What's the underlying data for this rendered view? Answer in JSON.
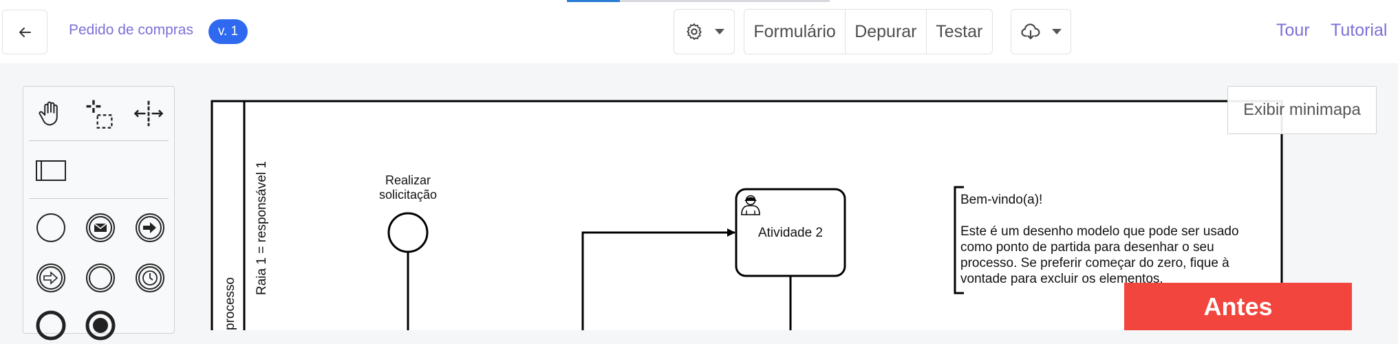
{
  "header": {
    "breadcrumb": "Pedido de compras",
    "version": "v. 1",
    "actions": [
      "Formulário",
      "Depurar",
      "Testar"
    ],
    "links": {
      "tour": "Tour",
      "tutorial": "Tutorial"
    }
  },
  "canvas": {
    "minimap_label": "Exibir minimapa",
    "pool_label": "processo",
    "lane_label": "Raia 1 = responsável 1",
    "start_event_label_line1": "Realizar",
    "start_event_label_line2": "solicitação",
    "task_label": "Atividade 2",
    "annotation": {
      "title": "Bem-vindo(a)!",
      "body": "Este é um desenho modelo que pode ser usado como ponto de partida para desenhar o seu processo. Se preferir começar do zero, fique à vontade para excluir os elementos."
    }
  },
  "overlay_badge": "Antes",
  "colors": {
    "accent": "#2f69f0",
    "link": "#7b70d8",
    "badge_red": "#f2453d",
    "tab_indicator": "#2a7bd4"
  }
}
